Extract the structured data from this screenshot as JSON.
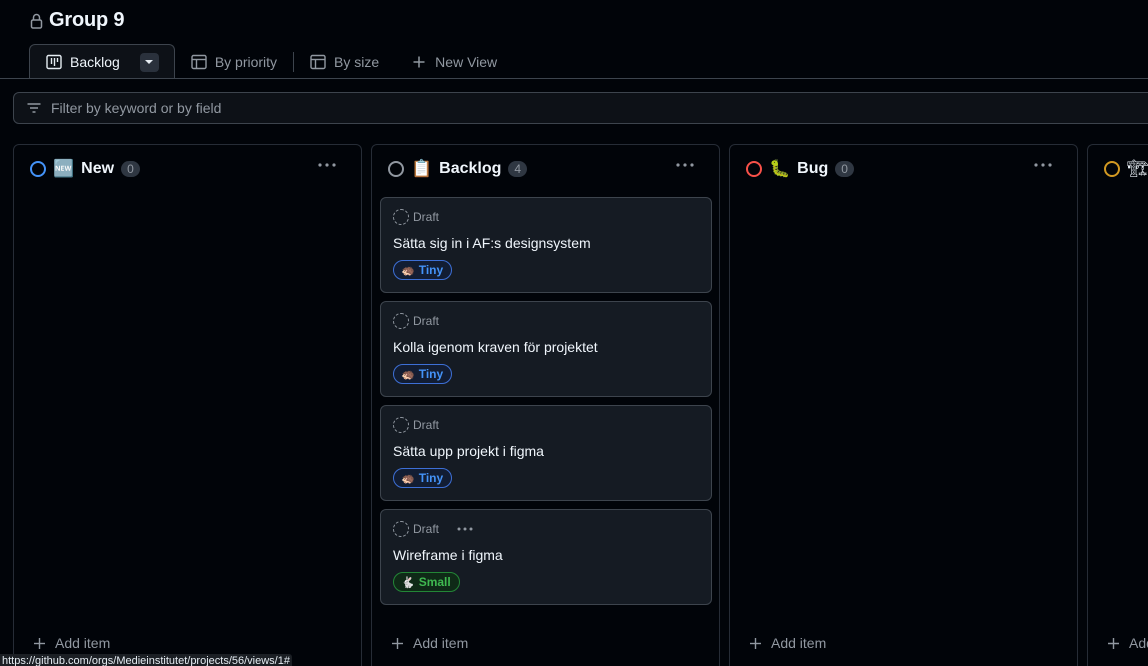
{
  "project": {
    "title": "Group 9",
    "lock_icon": "lock-icon"
  },
  "tabs": [
    {
      "label": "Backlog",
      "icon": "board-icon",
      "active": true
    },
    {
      "label": "By priority",
      "icon": "table-icon",
      "active": false
    },
    {
      "label": "By size",
      "icon": "table-icon",
      "active": false
    },
    {
      "label": "New View",
      "icon": "plus-icon",
      "active": false
    }
  ],
  "filter": {
    "placeholder": "Filter by keyword or by field"
  },
  "colors": {
    "new": "#4493f8",
    "backlog": "#9198a1",
    "bug": "#f85149",
    "next": "#d29922",
    "tiny_badge": "#4493f8",
    "small_badge": "#3fb950"
  },
  "columns": [
    {
      "emoji": "🆕",
      "name": "New",
      "count": "0",
      "status_color": "#4493f8"
    },
    {
      "emoji": "📋",
      "name": "Backlog",
      "count": "4",
      "status_color": "#9198a1"
    },
    {
      "emoji": "🐛",
      "name": "Bug",
      "count": "0",
      "status_color": "#f85149"
    },
    {
      "emoji": "🏗",
      "name": "",
      "count": "",
      "status_color": "#d29922"
    }
  ],
  "cards": [
    {
      "status": "Draft",
      "title": "Sätta sig in i AF:s designsystem",
      "size_emoji": "🦔",
      "size": "Tiny"
    },
    {
      "status": "Draft",
      "title": "Kolla igenom kraven för projektet",
      "size_emoji": "🦔",
      "size": "Tiny"
    },
    {
      "status": "Draft",
      "title": "Sätta upp projekt i figma",
      "size_emoji": "🦔",
      "size": "Tiny"
    },
    {
      "status": "Draft",
      "title": "Wireframe i figma",
      "size_emoji": "🐇",
      "size": "Small"
    }
  ],
  "add_item_label": "Add item",
  "partial_add_item_label": "Add",
  "status_bar": {
    "url": "https://github.com/orgs/Medieinstitutet/projects/56/views/1#"
  }
}
